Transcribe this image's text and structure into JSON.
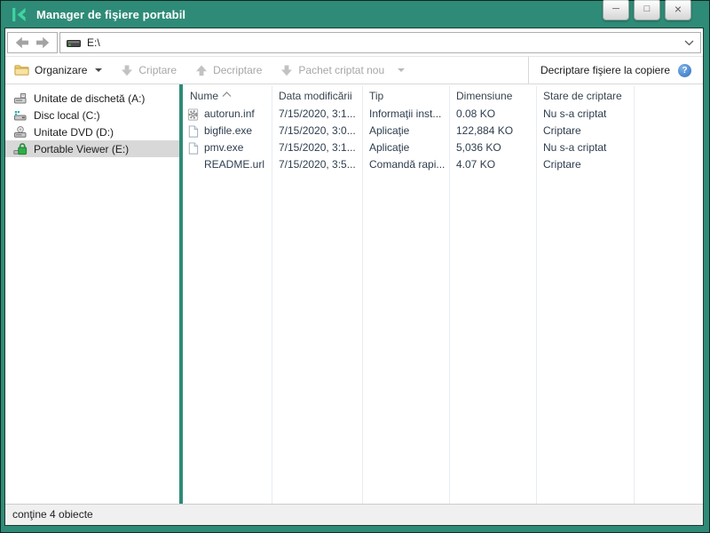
{
  "window": {
    "title": "Manager de fişiere portabil",
    "minimize": "─",
    "maximize": "□",
    "close": "×"
  },
  "navbar": {
    "address": "E:\\"
  },
  "toolbar": {
    "organize": "Organizare",
    "encrypt": "Criptare",
    "decrypt": "Decriptare",
    "new_encrypted_package": "Pachet criptat nou",
    "decrypt_on_copy": "Decriptare fişiere la copiere",
    "help": "?"
  },
  "sidebar": {
    "items": [
      {
        "label": "Unitate de dischetă (A:)",
        "icon": "floppy-drive-icon",
        "selected": false
      },
      {
        "label": "Disc local (C:)",
        "icon": "local-disk-icon",
        "selected": false
      },
      {
        "label": "Unitate DVD (D:)",
        "icon": "dvd-drive-icon",
        "selected": false
      },
      {
        "label": "Portable Viewer (E:)",
        "icon": "encrypted-drive-icon",
        "selected": true
      }
    ]
  },
  "filelist": {
    "columns": [
      "Nume",
      "Data modificării",
      "Tip",
      "Dimensiune",
      "Stare de criptare"
    ],
    "sorted_by": "Nume",
    "sort_direction": "ascending",
    "rows": [
      {
        "name": "autorun.inf",
        "date": "7/15/2020, 3:1...",
        "type": "Informaţii inst...",
        "size": "0.08 KO",
        "status": "Nu s-a criptat",
        "icon": "setup-file-icon"
      },
      {
        "name": "bigfile.exe",
        "date": "7/15/2020, 3:0...",
        "type": "Aplicaţie",
        "size": "122,884 KO",
        "status": "Criptare",
        "icon": "file-icon"
      },
      {
        "name": "pmv.exe",
        "date": "7/15/2020, 3:1...",
        "type": "Aplicaţie",
        "size": "5,036 KO",
        "status": "Nu s-a criptat",
        "icon": "file-icon"
      },
      {
        "name": "README.url",
        "date": "7/15/2020, 3:5...",
        "type": "Comandă rapi...",
        "size": "4.07 KO",
        "status": "Criptare",
        "icon": "none"
      }
    ]
  },
  "statusbar": {
    "text": "conţine 4 obiecte"
  },
  "colors": {
    "titlebar": "#2e8b77",
    "logo": "#3fd3a2",
    "selection": "#d8d8d8",
    "help_icon": "#2f6fc0",
    "disabled_text": "#a7a7a7"
  }
}
